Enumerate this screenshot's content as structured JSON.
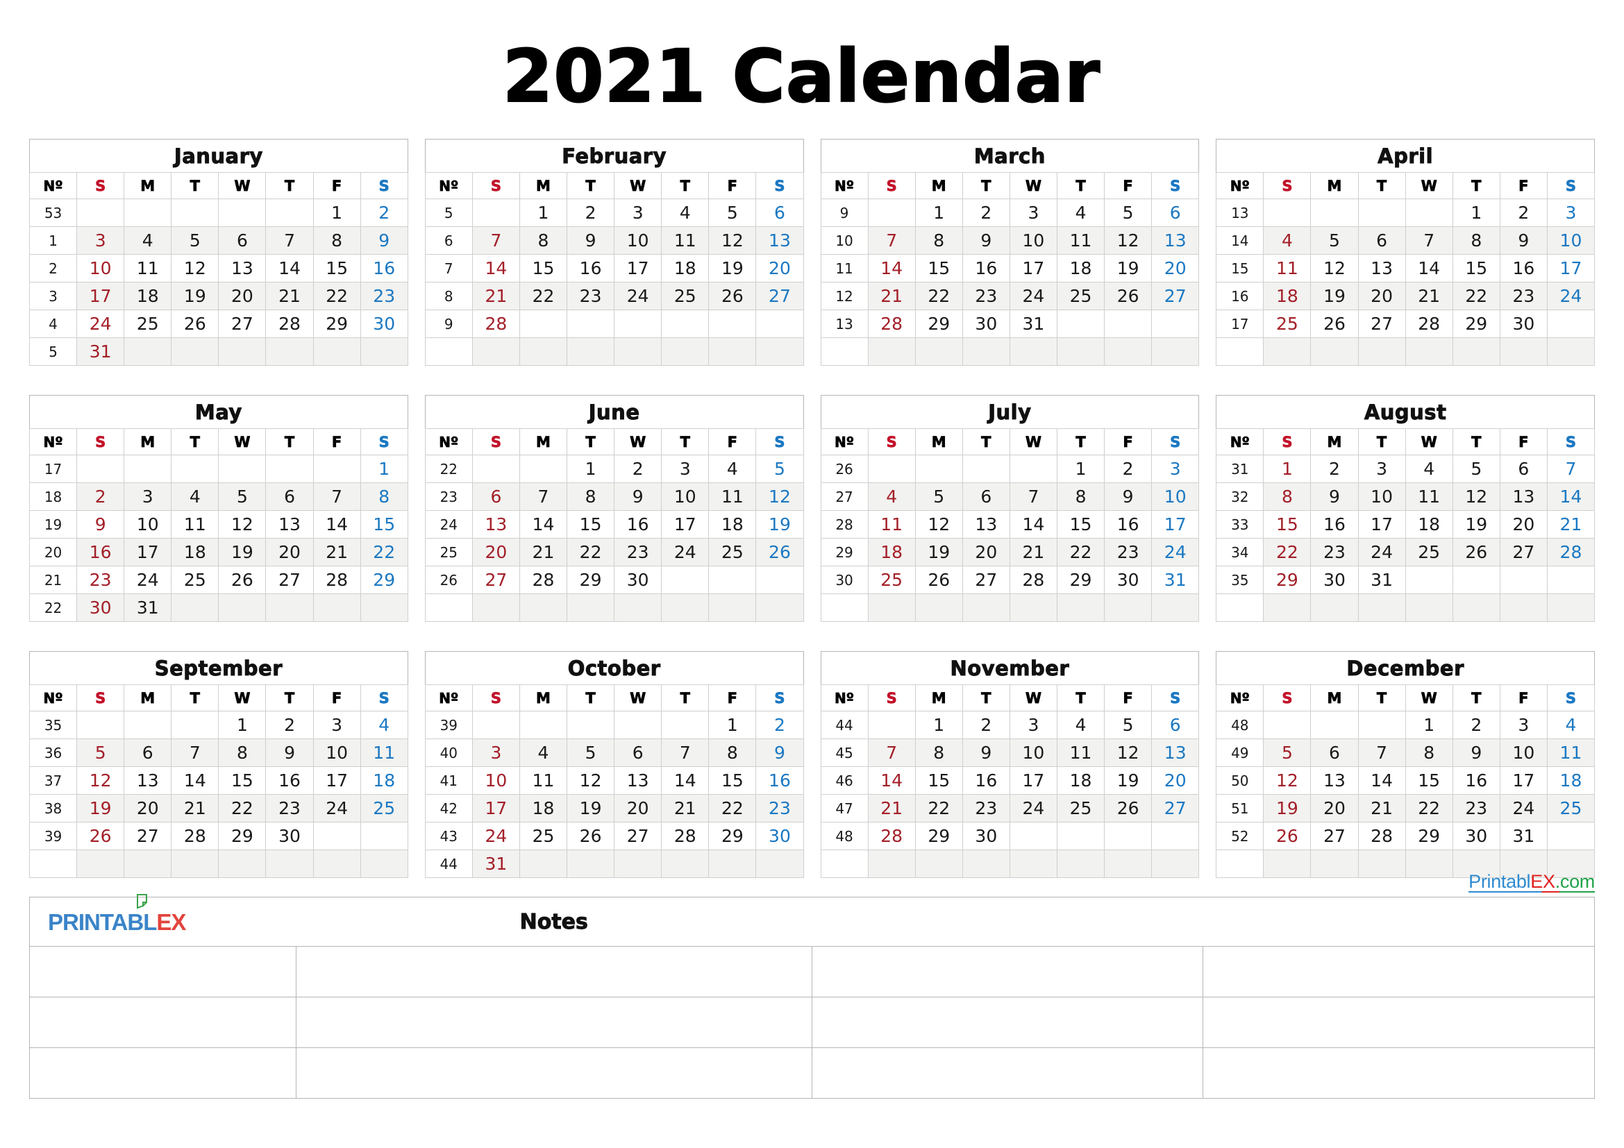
{
  "title": "2021 Calendar",
  "colors": {
    "sunday": "#c2132a",
    "saturday": "#1b78c2",
    "text": "#1a1a1a",
    "grid": "#cfcfcf",
    "shade": "#f2f2f0"
  },
  "dow_headers": [
    "Nº",
    "S",
    "M",
    "T",
    "W",
    "T",
    "F",
    "S"
  ],
  "notes": {
    "title": "Notes",
    "logo_blue": "PRINTABL",
    "logo_red": "EX",
    "rows": 3,
    "columns": 4
  },
  "watermark": {
    "part1": "Printabl",
    "part2": "EX",
    "part3": ".com"
  },
  "months": [
    {
      "name": "January",
      "weeks": [
        {
          "no": "53",
          "days": [
            "",
            "",
            "",
            "",
            "",
            "1",
            "2"
          ]
        },
        {
          "no": "1",
          "days": [
            "3",
            "4",
            "5",
            "6",
            "7",
            "8",
            "9"
          ]
        },
        {
          "no": "2",
          "days": [
            "10",
            "11",
            "12",
            "13",
            "14",
            "15",
            "16"
          ]
        },
        {
          "no": "3",
          "days": [
            "17",
            "18",
            "19",
            "20",
            "21",
            "22",
            "23"
          ]
        },
        {
          "no": "4",
          "days": [
            "24",
            "25",
            "26",
            "27",
            "28",
            "29",
            "30"
          ]
        },
        {
          "no": "5",
          "days": [
            "31",
            "",
            "",
            "",
            "",
            "",
            ""
          ]
        }
      ]
    },
    {
      "name": "February",
      "weeks": [
        {
          "no": "5",
          "days": [
            "",
            "1",
            "2",
            "3",
            "4",
            "5",
            "6"
          ]
        },
        {
          "no": "6",
          "days": [
            "7",
            "8",
            "9",
            "10",
            "11",
            "12",
            "13"
          ]
        },
        {
          "no": "7",
          "days": [
            "14",
            "15",
            "16",
            "17",
            "18",
            "19",
            "20"
          ]
        },
        {
          "no": "8",
          "days": [
            "21",
            "22",
            "23",
            "24",
            "25",
            "26",
            "27"
          ]
        },
        {
          "no": "9",
          "days": [
            "28",
            "",
            "",
            "",
            "",
            "",
            ""
          ]
        },
        {
          "no": "",
          "days": [
            "",
            "",
            "",
            "",
            "",
            "",
            ""
          ]
        }
      ]
    },
    {
      "name": "March",
      "weeks": [
        {
          "no": "9",
          "days": [
            "",
            "1",
            "2",
            "3",
            "4",
            "5",
            "6"
          ]
        },
        {
          "no": "10",
          "days": [
            "7",
            "8",
            "9",
            "10",
            "11",
            "12",
            "13"
          ]
        },
        {
          "no": "11",
          "days": [
            "14",
            "15",
            "16",
            "17",
            "18",
            "19",
            "20"
          ]
        },
        {
          "no": "12",
          "days": [
            "21",
            "22",
            "23",
            "24",
            "25",
            "26",
            "27"
          ]
        },
        {
          "no": "13",
          "days": [
            "28",
            "29",
            "30",
            "31",
            "",
            "",
            ""
          ]
        },
        {
          "no": "",
          "days": [
            "",
            "",
            "",
            "",
            "",
            "",
            ""
          ]
        }
      ]
    },
    {
      "name": "April",
      "weeks": [
        {
          "no": "13",
          "days": [
            "",
            "",
            "",
            "",
            "1",
            "2",
            "3"
          ]
        },
        {
          "no": "14",
          "days": [
            "4",
            "5",
            "6",
            "7",
            "8",
            "9",
            "10"
          ]
        },
        {
          "no": "15",
          "days": [
            "11",
            "12",
            "13",
            "14",
            "15",
            "16",
            "17"
          ]
        },
        {
          "no": "16",
          "days": [
            "18",
            "19",
            "20",
            "21",
            "22",
            "23",
            "24"
          ]
        },
        {
          "no": "17",
          "days": [
            "25",
            "26",
            "27",
            "28",
            "29",
            "30",
            ""
          ]
        },
        {
          "no": "",
          "days": [
            "",
            "",
            "",
            "",
            "",
            "",
            ""
          ]
        }
      ]
    },
    {
      "name": "May",
      "weeks": [
        {
          "no": "17",
          "days": [
            "",
            "",
            "",
            "",
            "",
            "",
            "1"
          ]
        },
        {
          "no": "18",
          "days": [
            "2",
            "3",
            "4",
            "5",
            "6",
            "7",
            "8"
          ]
        },
        {
          "no": "19",
          "days": [
            "9",
            "10",
            "11",
            "12",
            "13",
            "14",
            "15"
          ]
        },
        {
          "no": "20",
          "days": [
            "16",
            "17",
            "18",
            "19",
            "20",
            "21",
            "22"
          ]
        },
        {
          "no": "21",
          "days": [
            "23",
            "24",
            "25",
            "26",
            "27",
            "28",
            "29"
          ]
        },
        {
          "no": "22",
          "days": [
            "30",
            "31",
            "",
            "",
            "",
            "",
            ""
          ]
        }
      ]
    },
    {
      "name": "June",
      "weeks": [
        {
          "no": "22",
          "days": [
            "",
            "",
            "1",
            "2",
            "3",
            "4",
            "5"
          ]
        },
        {
          "no": "23",
          "days": [
            "6",
            "7",
            "8",
            "9",
            "10",
            "11",
            "12"
          ]
        },
        {
          "no": "24",
          "days": [
            "13",
            "14",
            "15",
            "16",
            "17",
            "18",
            "19"
          ]
        },
        {
          "no": "25",
          "days": [
            "20",
            "21",
            "22",
            "23",
            "24",
            "25",
            "26"
          ]
        },
        {
          "no": "26",
          "days": [
            "27",
            "28",
            "29",
            "30",
            "",
            "",
            ""
          ]
        },
        {
          "no": "",
          "days": [
            "",
            "",
            "",
            "",
            "",
            "",
            ""
          ]
        }
      ]
    },
    {
      "name": "July",
      "weeks": [
        {
          "no": "26",
          "days": [
            "",
            "",
            "",
            "",
            "1",
            "2",
            "3"
          ]
        },
        {
          "no": "27",
          "days": [
            "4",
            "5",
            "6",
            "7",
            "8",
            "9",
            "10"
          ]
        },
        {
          "no": "28",
          "days": [
            "11",
            "12",
            "13",
            "14",
            "15",
            "16",
            "17"
          ]
        },
        {
          "no": "29",
          "days": [
            "18",
            "19",
            "20",
            "21",
            "22",
            "23",
            "24"
          ]
        },
        {
          "no": "30",
          "days": [
            "25",
            "26",
            "27",
            "28",
            "29",
            "30",
            "31"
          ]
        },
        {
          "no": "",
          "days": [
            "",
            "",
            "",
            "",
            "",
            "",
            ""
          ]
        }
      ]
    },
    {
      "name": "August",
      "weeks": [
        {
          "no": "31",
          "days": [
            "1",
            "2",
            "3",
            "4",
            "5",
            "6",
            "7"
          ]
        },
        {
          "no": "32",
          "days": [
            "8",
            "9",
            "10",
            "11",
            "12",
            "13",
            "14"
          ]
        },
        {
          "no": "33",
          "days": [
            "15",
            "16",
            "17",
            "18",
            "19",
            "20",
            "21"
          ]
        },
        {
          "no": "34",
          "days": [
            "22",
            "23",
            "24",
            "25",
            "26",
            "27",
            "28"
          ]
        },
        {
          "no": "35",
          "days": [
            "29",
            "30",
            "31",
            "",
            "",
            "",
            ""
          ]
        },
        {
          "no": "",
          "days": [
            "",
            "",
            "",
            "",
            "",
            "",
            ""
          ]
        }
      ]
    },
    {
      "name": "September",
      "weeks": [
        {
          "no": "35",
          "days": [
            "",
            "",
            "",
            "1",
            "2",
            "3",
            "4"
          ]
        },
        {
          "no": "36",
          "days": [
            "5",
            "6",
            "7",
            "8",
            "9",
            "10",
            "11"
          ]
        },
        {
          "no": "37",
          "days": [
            "12",
            "13",
            "14",
            "15",
            "16",
            "17",
            "18"
          ]
        },
        {
          "no": "38",
          "days": [
            "19",
            "20",
            "21",
            "22",
            "23",
            "24",
            "25"
          ]
        },
        {
          "no": "39",
          "days": [
            "26",
            "27",
            "28",
            "29",
            "30",
            "",
            ""
          ]
        },
        {
          "no": "",
          "days": [
            "",
            "",
            "",
            "",
            "",
            "",
            ""
          ]
        }
      ]
    },
    {
      "name": "October",
      "weeks": [
        {
          "no": "39",
          "days": [
            "",
            "",
            "",
            "",
            "",
            "1",
            "2"
          ]
        },
        {
          "no": "40",
          "days": [
            "3",
            "4",
            "5",
            "6",
            "7",
            "8",
            "9"
          ]
        },
        {
          "no": "41",
          "days": [
            "10",
            "11",
            "12",
            "13",
            "14",
            "15",
            "16"
          ]
        },
        {
          "no": "42",
          "days": [
            "17",
            "18",
            "19",
            "20",
            "21",
            "22",
            "23"
          ]
        },
        {
          "no": "43",
          "days": [
            "24",
            "25",
            "26",
            "27",
            "28",
            "29",
            "30"
          ]
        },
        {
          "no": "44",
          "days": [
            "31",
            "",
            "",
            "",
            "",
            "",
            ""
          ]
        }
      ]
    },
    {
      "name": "November",
      "weeks": [
        {
          "no": "44",
          "days": [
            "",
            "1",
            "2",
            "3",
            "4",
            "5",
            "6"
          ]
        },
        {
          "no": "45",
          "days": [
            "7",
            "8",
            "9",
            "10",
            "11",
            "12",
            "13"
          ]
        },
        {
          "no": "46",
          "days": [
            "14",
            "15",
            "16",
            "17",
            "18",
            "19",
            "20"
          ]
        },
        {
          "no": "47",
          "days": [
            "21",
            "22",
            "23",
            "24",
            "25",
            "26",
            "27"
          ]
        },
        {
          "no": "48",
          "days": [
            "28",
            "29",
            "30",
            "",
            "",
            "",
            ""
          ]
        },
        {
          "no": "",
          "days": [
            "",
            "",
            "",
            "",
            "",
            "",
            ""
          ]
        }
      ]
    },
    {
      "name": "December",
      "weeks": [
        {
          "no": "48",
          "days": [
            "",
            "",
            "",
            "1",
            "2",
            "3",
            "4"
          ]
        },
        {
          "no": "49",
          "days": [
            "5",
            "6",
            "7",
            "8",
            "9",
            "10",
            "11"
          ]
        },
        {
          "no": "50",
          "days": [
            "12",
            "13",
            "14",
            "15",
            "16",
            "17",
            "18"
          ]
        },
        {
          "no": "51",
          "days": [
            "19",
            "20",
            "21",
            "22",
            "23",
            "24",
            "25"
          ]
        },
        {
          "no": "52",
          "days": [
            "26",
            "27",
            "28",
            "29",
            "30",
            "31",
            ""
          ]
        },
        {
          "no": "",
          "days": [
            "",
            "",
            "",
            "",
            "",
            "",
            ""
          ]
        }
      ]
    }
  ]
}
